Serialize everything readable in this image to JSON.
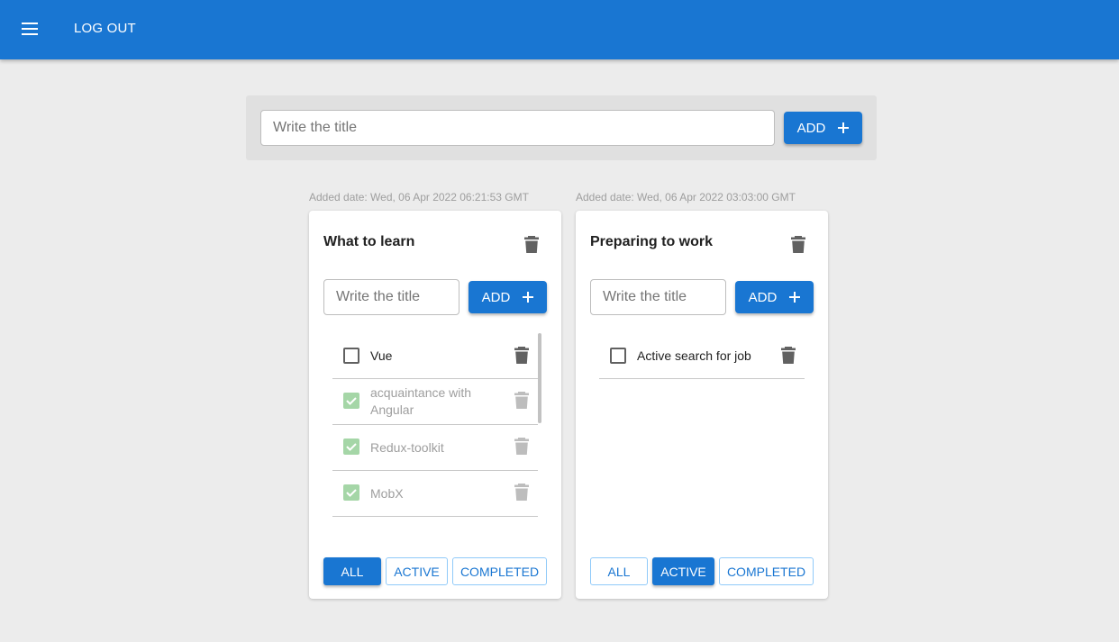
{
  "appbar": {
    "menu_icon": "menu-icon",
    "logout_label": "LOG OUT"
  },
  "top_form": {
    "placeholder": "Write the title",
    "add_label": "ADD"
  },
  "lists": [
    {
      "added_date": "Added date: Wed, 06 Apr 2022 06:21:53 GMT",
      "title": "What to learn",
      "input_placeholder": "Write the title",
      "add_label": "ADD",
      "tasks": [
        {
          "title": "Vue",
          "done": false
        },
        {
          "title": "acquaintance with Angular",
          "done": true
        },
        {
          "title": "Redux-toolkit",
          "done": true
        },
        {
          "title": "MobX",
          "done": true
        }
      ],
      "filters": [
        "ALL",
        "ACTIVE",
        "COMPLETED"
      ],
      "active_filter": "ALL"
    },
    {
      "added_date": "Added date: Wed, 06 Apr 2022 03:03:00 GMT",
      "title": "Preparing to work",
      "input_placeholder": "Write the title",
      "add_label": "ADD",
      "tasks": [
        {
          "title": "Active search for job",
          "done": false
        }
      ],
      "filters": [
        "ALL",
        "ACTIVE",
        "COMPLETED"
      ],
      "active_filter": "ACTIVE"
    }
  ],
  "colors": {
    "primary": "#1976d2",
    "done_check": "#a5d6a7",
    "background": "#ececec"
  }
}
